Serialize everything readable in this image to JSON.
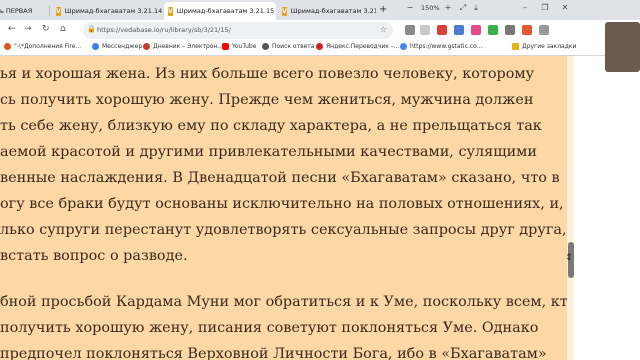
{
  "tabs": [
    {
      "label": "ь ПЕРВАЯ",
      "active": false
    },
    {
      "label": "Шримад-бхагаватам 3.21.14",
      "active": false
    },
    {
      "label": "Шримад-бхагаватам 3.21.15",
      "active": true
    },
    {
      "label": "Шримад-бхагаватам 3.21.16",
      "active": false
    }
  ],
  "toolbar": {
    "zoom": "150%",
    "url": "https://vedabase.io/ru/library/sb/3/21/15/"
  },
  "bookmarks": [
    {
      "label": "\"-\\*Дополнения Fire...",
      "color": "#e0531f"
    },
    {
      "label": "Мессенджер",
      "color": "#3b7ded"
    },
    {
      "label": "Дневник – Электрон...",
      "color": "#c43d2e"
    },
    {
      "label": "YouTube",
      "color": "#ff0000"
    },
    {
      "label": "Поиск ответа",
      "color": "#555555"
    },
    {
      "label": "Яндекс.Переводчик –...",
      "color": "#cc2222"
    },
    {
      "label": "https://www.gstatic.co...",
      "color": "#4285f4"
    },
    {
      "label": "Другие закладки",
      "color": "#e8b21a"
    }
  ],
  "content": {
    "lines": [
      "ья и хорошая жена. Из них больше всего повезло человеку, которому",
      "сь получить хорошую жену. Прежде чем жениться, мужчина должен",
      "ть себе жену, близкую ему по складу характера, а не прельщаться так",
      "аемой красотой и другими привлекательными качествами, сулящими",
      "венные наслаждения. В Двенадцатой песни «Бхагаватам» сказано, что в",
      "огу все браки будут основаны исключительно на половых отношениях, и,",
      "лько супруги перестанут удовлетворять сексуальные запросы друг друга,",
      "встать вопрос о разводе."
    ],
    "lines2": [
      "бной просьбой Кардама Муни мог обратиться и к Уме, поскольку всем, кто",
      " получить хорошую жену, писания советуют поклоняться Уме. Однако",
      "  предпочел поклоняться Верховной Личности Бога, ибо в «Бхагаватам»"
    ]
  }
}
